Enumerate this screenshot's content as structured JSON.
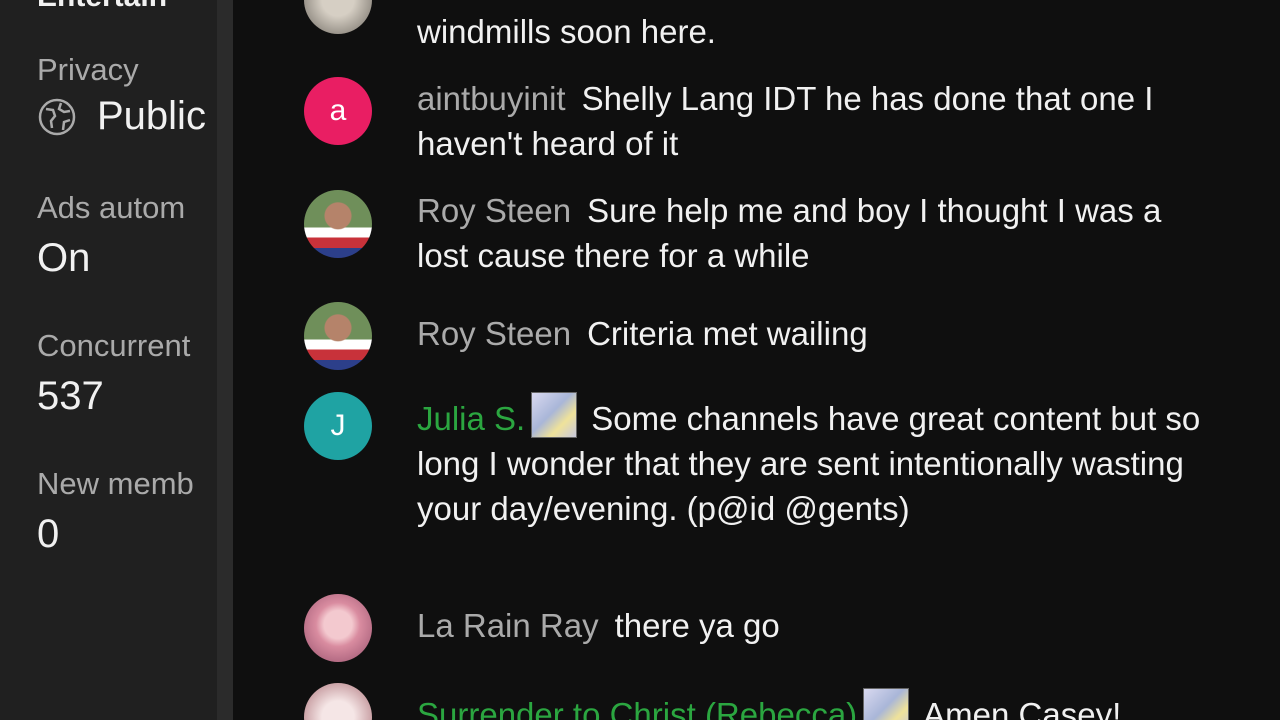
{
  "left_panel": {
    "cut_heading": "Entertain",
    "stats": [
      {
        "label": "Privacy",
        "value": "Public",
        "icon": "globe-icon"
      },
      {
        "label": "Ads autom",
        "value": "On"
      },
      {
        "label": "Concurrent",
        "value": "537"
      },
      {
        "label": "New memb",
        "value": "0"
      }
    ]
  },
  "chat": {
    "messages": [
      {
        "author": "",
        "text": "windmills soon here.",
        "avatar": "photo"
      },
      {
        "author": "aintbuyinit",
        "text": "Shelly Lang IDT he has done that one I haven't heard of it",
        "avatar_letter": "a",
        "avatar_color": "#e91e63"
      },
      {
        "author": "Roy Steen",
        "text": "Sure help me and boy I thought I was a lost cause there for a while",
        "avatar": "photo"
      },
      {
        "author": "Roy Steen",
        "text": "Criteria met wailing",
        "avatar": "photo"
      },
      {
        "author": "Julia S.",
        "text": "Some channels have great content but so long I wonder that they are sent intentionally wasting your day/evening. (p@id @gents)",
        "avatar_letter": "J",
        "avatar_color": "#1fa3a3",
        "member": true
      },
      {
        "author": "La Rain Ray",
        "text": "there ya go",
        "avatar": "photo"
      },
      {
        "author": "Surrender to Christ (Rebecca)",
        "text": "Amen Casey!",
        "avatar": "photo",
        "member": true
      }
    ]
  },
  "colors": {
    "member_name": "#2ba640",
    "author_name": "#aaaaaa",
    "background": "#0f0f0f",
    "panel": "#202020"
  }
}
